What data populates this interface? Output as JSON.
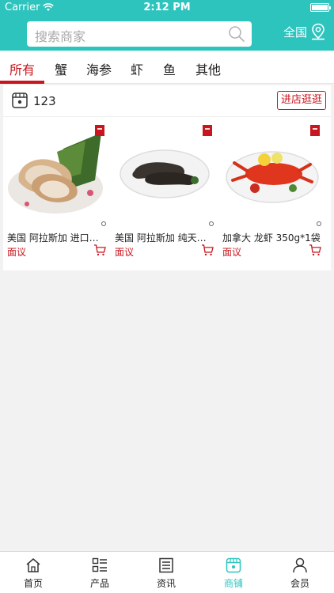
{
  "status_bar": {
    "carrier": "Carrier",
    "time": "2:12 PM"
  },
  "search": {
    "placeholder": "搜索商家"
  },
  "region": {
    "label": "全国"
  },
  "tabs": [
    {
      "label": "所有",
      "active": true
    },
    {
      "label": "蟹"
    },
    {
      "label": "海参"
    },
    {
      "label": "虾"
    },
    {
      "label": "鱼"
    },
    {
      "label": "其他"
    }
  ],
  "shop": {
    "name": "123",
    "enter_label": "进店逛逛",
    "products": [
      {
        "title": "美国 阿拉斯加 进口…",
        "price": "面议",
        "image": "fish-steak"
      },
      {
        "title": "美国 阿拉斯加 纯天…",
        "price": "面议",
        "image": "sea-cucumber"
      },
      {
        "title": "加拿大 龙虾 350g*1袋",
        "price": "面议",
        "image": "lobster"
      }
    ]
  },
  "tabbar": [
    {
      "label": "首页",
      "icon": "home-icon"
    },
    {
      "label": "产品",
      "icon": "product-list-icon"
    },
    {
      "label": "资讯",
      "icon": "news-icon"
    },
    {
      "label": "商铺",
      "icon": "shop-icon",
      "active": true
    },
    {
      "label": "会员",
      "icon": "user-icon"
    }
  ],
  "colors": {
    "header": "#2ec4be",
    "accent_red": "#c8161e",
    "active_nav": "#2ec4be"
  }
}
